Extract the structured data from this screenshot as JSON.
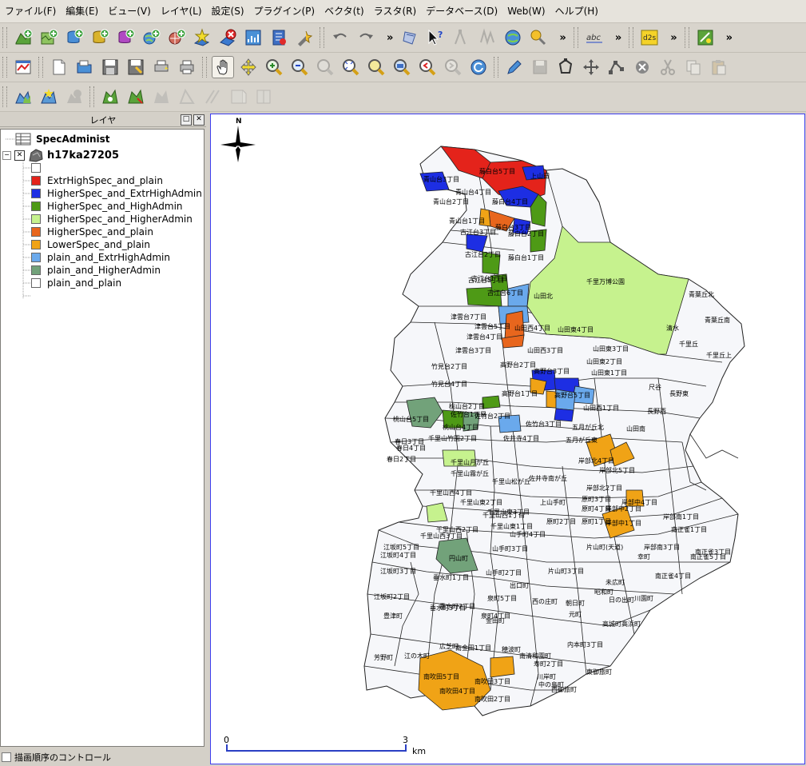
{
  "menu": [
    "ファイル(F)",
    "編集(E)",
    "ビュー(V)",
    "レイヤ(L)",
    "設定(S)",
    "プラグイン(P)",
    "ベクタ(t)",
    "ラスタ(R)",
    "データベース(D)",
    "Web(W)",
    "ヘルプ(H)"
  ],
  "toolbar_more": "»",
  "panel": {
    "title": "レイヤ",
    "float_btn": "□",
    "close_btn": "✕",
    "layers": [
      {
        "name": "SpecAdminist"
      },
      {
        "name": "h17ka27205"
      }
    ],
    "legend": [
      {
        "label": "",
        "color": "#ffffff"
      },
      {
        "label": "ExtrHighSpec_and_plain",
        "color": "#e4231b"
      },
      {
        "label": "HigherSpec_and_ExtrHighAdmin",
        "color": "#1d2ee3"
      },
      {
        "label": "HigherSpec_and_HighAdmin",
        "color": "#4e9a16"
      },
      {
        "label": "HigherSpec_and_HigherAdmin",
        "color": "#c6f28e"
      },
      {
        "label": "HigherSpec_and_plain",
        "color": "#e8661d"
      },
      {
        "label": "LowerSpec_and_plain",
        "color": "#f0a316"
      },
      {
        "label": "plain_and_ExtrHighAdmin",
        "color": "#6aa9ec"
      },
      {
        "label": "plain_and_HigherAdmin",
        "color": "#72a27a"
      },
      {
        "label": "plain_and_plain",
        "color": "#ffffff"
      }
    ],
    "render_order": "描画順序のコントロール"
  },
  "map": {
    "north": "N",
    "scale": {
      "start": "0",
      "end": "3",
      "unit": "km"
    },
    "labels": [
      {
        "t": "上山田"
      },
      {
        "t": "藤白台5丁目"
      },
      {
        "t": "青山台3丁目"
      },
      {
        "t": "青山台4丁目"
      },
      {
        "t": "藤白台4丁目"
      },
      {
        "t": "青山台2丁目"
      },
      {
        "t": "青山台1丁目"
      },
      {
        "t": "藤白台3丁目"
      },
      {
        "t": "古江台3丁目"
      },
      {
        "t": "藤白台2丁目"
      },
      {
        "t": "古江台2丁目"
      },
      {
        "t": "藤白台1丁目"
      },
      {
        "t": "古江台5丁目"
      },
      {
        "t": "古江台1丁目"
      },
      {
        "t": "千里万博公園"
      },
      {
        "t": "古江台6丁目"
      },
      {
        "t": "山田北"
      },
      {
        "t": "青葉丘北"
      },
      {
        "t": "津雲台7丁目"
      },
      {
        "t": "津雲台5丁目"
      },
      {
        "t": "山田西4丁目"
      },
      {
        "t": "山田東4丁目"
      },
      {
        "t": "津雲台4丁目"
      },
      {
        "t": "清水"
      },
      {
        "t": "青葉丘南"
      },
      {
        "t": "津雲台3丁目"
      },
      {
        "t": "山田西3丁目"
      },
      {
        "t": "山田東3丁目"
      },
      {
        "t": "千里丘"
      },
      {
        "t": "竹見台2丁目"
      },
      {
        "t": "高野台2丁目"
      },
      {
        "t": "山田東2丁目"
      },
      {
        "t": "千里丘上"
      },
      {
        "t": "竹見台4丁目"
      },
      {
        "t": "高野台3丁目"
      },
      {
        "t": "山田東1丁目"
      },
      {
        "t": "尺谷"
      },
      {
        "t": "長野東"
      },
      {
        "t": "高野台1丁目"
      },
      {
        "t": "高野台5丁目"
      },
      {
        "t": "山田西1丁目"
      },
      {
        "t": "長野西"
      },
      {
        "t": "桃山台2丁目"
      },
      {
        "t": "佐竹台1丁目"
      },
      {
        "t": "佐竹台2丁目"
      },
      {
        "t": "山田南"
      },
      {
        "t": "桃山台5丁目"
      },
      {
        "t": "桃山台4丁目"
      },
      {
        "t": "佐竹台3丁目"
      },
      {
        "t": "五月が丘北"
      },
      {
        "t": "千里山竹園2丁目"
      },
      {
        "t": "佐井寺4丁目"
      },
      {
        "t": "五月が丘東"
      },
      {
        "t": "春日3丁目"
      },
      {
        "t": "春日4丁目"
      },
      {
        "t": "春日2丁目"
      },
      {
        "t": "千里山月が丘"
      },
      {
        "t": "岸部北4丁目"
      },
      {
        "t": "千里山霧が丘"
      },
      {
        "t": "佐井寺南が丘"
      },
      {
        "t": "岸部北5丁目"
      },
      {
        "t": "千里山松が丘"
      },
      {
        "t": "岸部北2丁目"
      },
      {
        "t": "千里山西4丁目"
      },
      {
        "t": "上山手町"
      },
      {
        "t": "岸部中4丁目"
      },
      {
        "t": "千里山東2丁目"
      },
      {
        "t": "原町3丁目"
      },
      {
        "t": "千里山西1丁目"
      },
      {
        "t": "千里山東3丁目"
      },
      {
        "t": "原町4丁目"
      },
      {
        "t": "岸部中2丁目"
      },
      {
        "t": "岸部南1丁目"
      },
      {
        "t": "千里山西2丁目"
      },
      {
        "t": "千里山東1丁目"
      },
      {
        "t": "原町2丁目"
      },
      {
        "t": "原町1丁目"
      },
      {
        "t": "岸部中1丁目"
      },
      {
        "t": "南正雀1丁目"
      },
      {
        "t": "千里山西3丁目"
      },
      {
        "t": "山手町4丁目"
      },
      {
        "t": "岸部南3丁目"
      },
      {
        "t": "江坂町5丁目"
      },
      {
        "t": "山手町3丁目"
      },
      {
        "t": "片山町(天道)"
      },
      {
        "t": "南正雀3丁目"
      },
      {
        "t": "江坂町4丁目"
      },
      {
        "t": "円山町"
      },
      {
        "t": "幸町"
      },
      {
        "t": "南正雀5丁目"
      },
      {
        "t": "江坂町3丁目"
      },
      {
        "t": "垂水町1丁目"
      },
      {
        "t": "山手町2丁目"
      },
      {
        "t": "片山町3丁目"
      },
      {
        "t": "未広町"
      },
      {
        "t": "南正雀4丁目"
      },
      {
        "t": "出口町"
      },
      {
        "t": "昭和町"
      },
      {
        "t": "江坂町2丁目"
      },
      {
        "t": "垂水町2丁目"
      },
      {
        "t": "泉町5丁目"
      },
      {
        "t": "西の庄町"
      },
      {
        "t": "朝日町"
      },
      {
        "t": "日の出町"
      },
      {
        "t": "川園町"
      },
      {
        "t": "垂水町3丁目"
      },
      {
        "t": "豊津町"
      },
      {
        "t": "泉町4丁目"
      },
      {
        "t": "金田町"
      },
      {
        "t": "元町"
      },
      {
        "t": "高城町"
      },
      {
        "t": "高浜町"
      },
      {
        "t": "芳野町"
      },
      {
        "t": "江の木町"
      },
      {
        "t": "広芝町"
      },
      {
        "t": "南金田1丁目"
      },
      {
        "t": "穂波町"
      },
      {
        "t": "内本町3丁目"
      },
      {
        "t": "南清和園町"
      },
      {
        "t": "寿町2丁目"
      },
      {
        "t": "南吹田5丁目"
      },
      {
        "t": "南吹田3丁目"
      },
      {
        "t": "川岸町"
      },
      {
        "t": "中の島町"
      },
      {
        "t": "東御旅町"
      },
      {
        "t": "南吹田4丁目"
      },
      {
        "t": "西御旅町"
      },
      {
        "t": "南吹田2丁目"
      }
    ]
  }
}
